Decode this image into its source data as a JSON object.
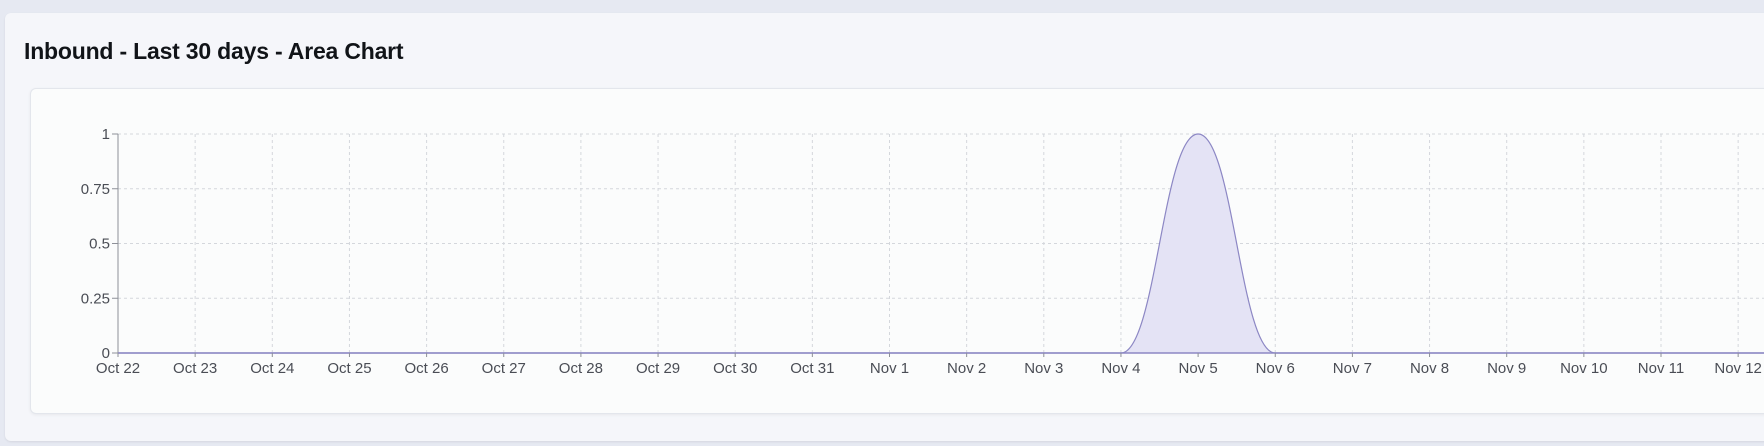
{
  "card": {
    "title": "Inbound - Last 30 days - Area Chart"
  },
  "chart_data": {
    "type": "area",
    "title": "Inbound - Last 30 days - Area Chart",
    "categories": [
      "Oct 22",
      "Oct 23",
      "Oct 24",
      "Oct 25",
      "Oct 26",
      "Oct 27",
      "Oct 28",
      "Oct 29",
      "Oct 30",
      "Oct 31",
      "Nov 1",
      "Nov 2",
      "Nov 3",
      "Nov 4",
      "Nov 5",
      "Nov 6",
      "Nov 7",
      "Nov 8",
      "Nov 9",
      "Nov 10",
      "Nov 11",
      "Nov 12"
    ],
    "series": [
      {
        "values": [
          0,
          0,
          0,
          0,
          0,
          0,
          0,
          0,
          0,
          0,
          0,
          0,
          0,
          0,
          1,
          0,
          0,
          0,
          0,
          0,
          0,
          0
        ]
      }
    ],
    "ylim": [
      0,
      1
    ],
    "yticks": [
      0,
      0.25,
      0.5,
      0.75,
      1
    ],
    "ytick_labels": [
      "0",
      "0.25",
      "0.5",
      "0.75",
      "1"
    ],
    "xlabel": "",
    "ylabel": "",
    "grid": true,
    "colors": {
      "fill": "#e4e3f5",
      "stroke": "#8c87c4",
      "grid": "#d4d7dc",
      "axis": "#8d9098",
      "baseline": "#8c87c4",
      "text": "#4a4d55"
    }
  }
}
